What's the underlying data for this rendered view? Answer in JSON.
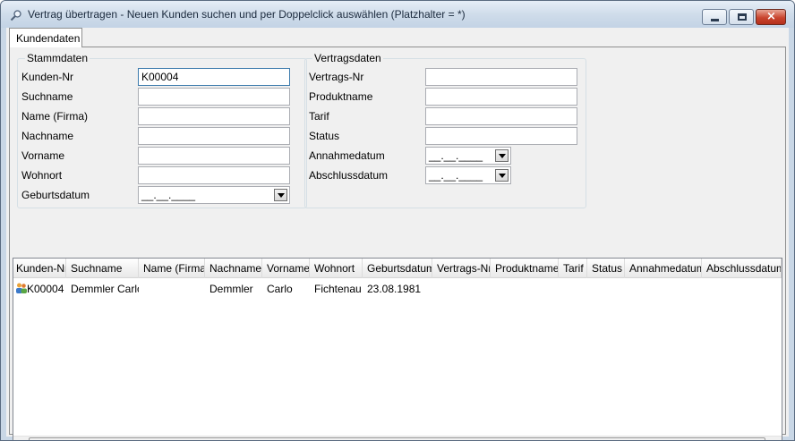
{
  "window": {
    "title": "Vertrag übertragen - Neuen Kunden suchen und per Doppelclick auswählen (Platzhalter = *)",
    "icon": "search-icon",
    "controls": {
      "minimize": "minimize-icon",
      "maximize": "maximize-icon",
      "close": "×"
    }
  },
  "tabs": [
    {
      "label": "Kundendaten",
      "active": true
    }
  ],
  "stammdaten": {
    "title": "Stammdaten",
    "fields": {
      "kunden_nr": {
        "label": "Kunden-Nr",
        "value": "K00004"
      },
      "suchname": {
        "label": "Suchname",
        "value": ""
      },
      "name_firma": {
        "label": "Name (Firma)",
        "value": ""
      },
      "nachname": {
        "label": "Nachname",
        "value": ""
      },
      "vorname": {
        "label": "Vorname",
        "value": ""
      },
      "wohnort": {
        "label": "Wohnort",
        "value": ""
      },
      "geburtsdatum": {
        "label": "Geburtsdatum",
        "value": "__.__.____"
      }
    }
  },
  "vertragsdaten": {
    "title": "Vertragsdaten",
    "fields": {
      "vertrags_nr": {
        "label": "Vertrags-Nr",
        "value": ""
      },
      "produktname": {
        "label": "Produktname",
        "value": ""
      },
      "tarif": {
        "label": "Tarif",
        "value": ""
      },
      "status": {
        "label": "Status",
        "value": ""
      },
      "annahmedatum": {
        "label": "Annahmedatum",
        "value": "__.__.____"
      },
      "abschlussdatum": {
        "label": "Abschlussdatum",
        "value": "__.__.____"
      }
    }
  },
  "grid": {
    "columns": [
      "Kunden-Nr",
      "Suchname",
      "Name (Firma)",
      "Nachname",
      "Vorname",
      "Wohnort",
      "Geburtsdatum",
      "Vertrags-Nr",
      "Produktname",
      "Tarif",
      "Status",
      "Annahmedatum",
      "Abschlussdatum"
    ],
    "rows": [
      {
        "kunden_nr": "K00004",
        "suchname": "Demmler Carlo",
        "name_firma": "",
        "nachname": "Demmler",
        "vorname": "Carlo",
        "wohnort": "Fichtenau",
        "geburtsdatum": "23.08.1981",
        "vertrags_nr": "",
        "produktname": "",
        "tarif": "",
        "status": "",
        "annahmedatum": "",
        "abschlussdatum": ""
      }
    ],
    "row_icon": "customer-icon"
  },
  "colors": {
    "title_bar": "#cfdcea",
    "close_button": "#c9452e",
    "panel": "#f0f0f0"
  }
}
